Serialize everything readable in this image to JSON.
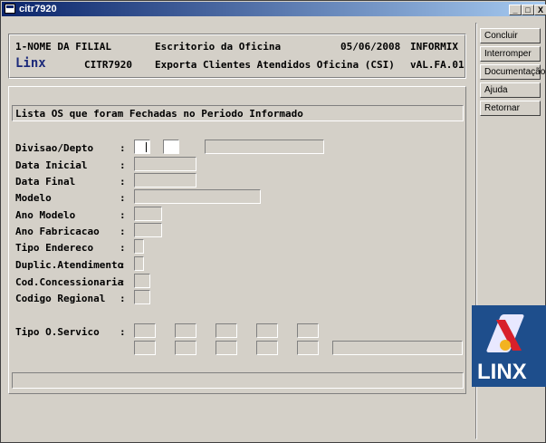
{
  "window": {
    "title": "citr7920",
    "min": "_",
    "max": "□",
    "close": "X"
  },
  "header": {
    "filial": "1-NOME DA FILIAL",
    "oficina": "Escritorio da Oficina",
    "date": "05/06/2008",
    "db": "INFORMIX",
    "brand": "Linx",
    "program": "CITR7920",
    "description": "Exporta Clientes Atendidos Oficina (CSI)",
    "version": "vAL.FA.01"
  },
  "form": {
    "section_title": "Lista OS que foram Fechadas no Periodo Informado",
    "labels": {
      "divisao": "Divisao/Depto",
      "data_inicial": "Data Inicial",
      "data_final": "Data Final",
      "modelo": "Modelo",
      "ano_modelo": "Ano Modelo",
      "ano_fabricacao": "Ano Fabricacao",
      "tipo_endereco": "Tipo Endereco",
      "duplic": "Duplic.Atendimento",
      "cod_conc": "Cod.Concessionaria",
      "codigo_regional": "Codigo Regional",
      "tipo_servico": "Tipo O.Servico"
    },
    "colon": ":"
  },
  "sidebar": {
    "buttons": [
      "Concluir",
      "Interromper",
      "Documentação",
      "Ajuda",
      "Retornar"
    ]
  },
  "logo": {
    "text": "LINX",
    "brand_color": "#1e4e8c"
  }
}
